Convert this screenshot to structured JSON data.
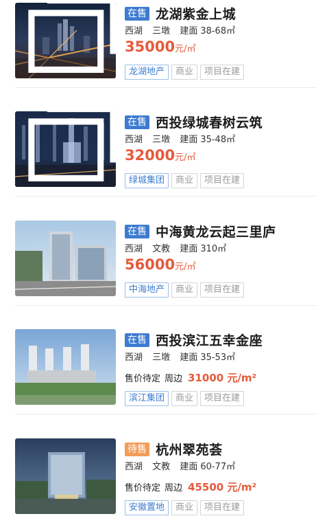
{
  "listings": [
    {
      "status": "在售",
      "name": "龙湖紫金上城",
      "district": "西湖",
      "area": "三墩",
      "size_label": "建面",
      "size": "38-68㎡",
      "price": "35000",
      "price_unit": "元/㎡",
      "tags": [
        "龙湖地产",
        "商业",
        "项目在建"
      ]
    },
    {
      "status": "在售",
      "name": "西投绿城春树云筑",
      "district": "西湖",
      "area": "三墩",
      "size_label": "建面",
      "size": "35-48㎡",
      "price": "32000",
      "price_unit": "元/㎡",
      "tags": [
        "绿城集团",
        "商业",
        "项目在建"
      ]
    },
    {
      "status": "在售",
      "name": "中海黄龙云起三里庐",
      "district": "西湖",
      "area": "文教",
      "size_label": "建面",
      "size": "310㎡",
      "price": "56000",
      "price_unit": "元/㎡",
      "tags": [
        "中海地产",
        "商业",
        "项目在建"
      ]
    },
    {
      "status": "在售",
      "name": "西投滨江五幸金座",
      "district": "西湖",
      "area": "三墩",
      "size_label": "建面",
      "size": "35-53㎡",
      "price_label": "售价待定",
      "nearby_label": "周边",
      "nearby_price": "31000 元/m²",
      "tags": [
        "滨江集团",
        "商业",
        "项目在建"
      ]
    },
    {
      "status": "待售",
      "name": "杭州翠苑荟",
      "district": "西湖",
      "area": "文教",
      "size_label": "建面",
      "size": "60-77㎡",
      "price_label": "售价待定",
      "nearby_label": "周边",
      "nearby_price": "45500 元/m²",
      "tags": [
        "安徽置地",
        "商业",
        "项目在建"
      ]
    }
  ],
  "icons": {
    "album": "album-icon"
  },
  "colors": {
    "on_sale": "#3d7bd0",
    "pending": "#f29c5a",
    "price": "#e65a3b"
  }
}
